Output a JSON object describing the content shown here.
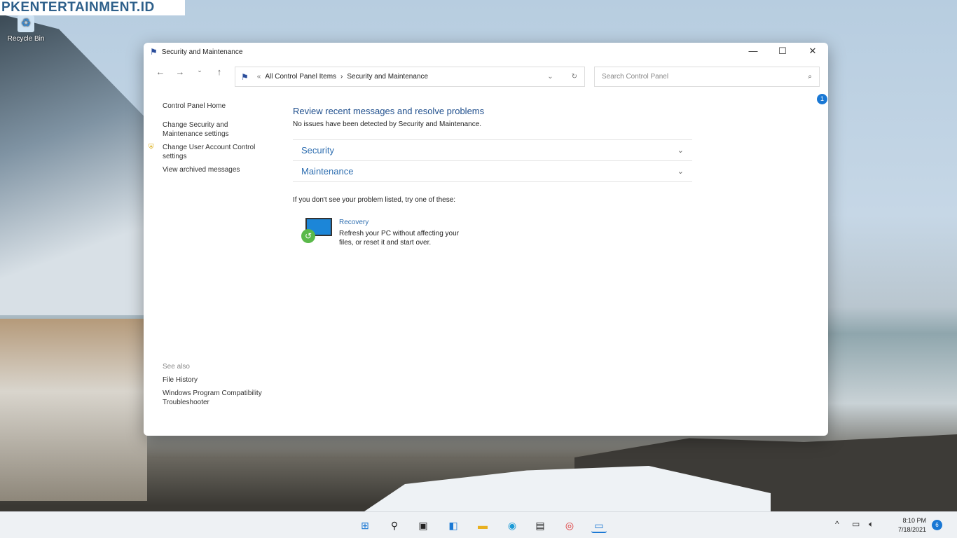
{
  "watermark": "PKENTERTAINMENT.ID",
  "desktop": {
    "recycle_bin": "Recycle Bin"
  },
  "window": {
    "title": "Security and Maintenance",
    "breadcrumb": [
      "All Control Panel Items",
      "Security and Maintenance"
    ],
    "search_placeholder": "Search Control Panel"
  },
  "sidebar": {
    "items": [
      "Control Panel Home",
      "Change Security and Maintenance settings",
      "Change User Account Control settings",
      "View archived messages"
    ],
    "see_also_label": "See also",
    "see_also": [
      "File History",
      "Windows Program Compatibility Troubleshooter"
    ]
  },
  "main": {
    "heading": "Review recent messages and resolve problems",
    "status": "No issues have been detected by Security and Maintenance.",
    "sections": [
      "Security",
      "Maintenance"
    ],
    "hint": "If you don't see your problem listed, try one of these:",
    "recovery": {
      "title": "Recovery",
      "desc": "Refresh your PC without affecting your files, or reset it and start over."
    }
  },
  "notification_count": "1",
  "tray": {
    "time": "8:10 PM",
    "date": "7/18/2021",
    "badge": "6"
  },
  "colors": {
    "accent": "#2e6eb0",
    "heading": "#1e4e8c"
  }
}
